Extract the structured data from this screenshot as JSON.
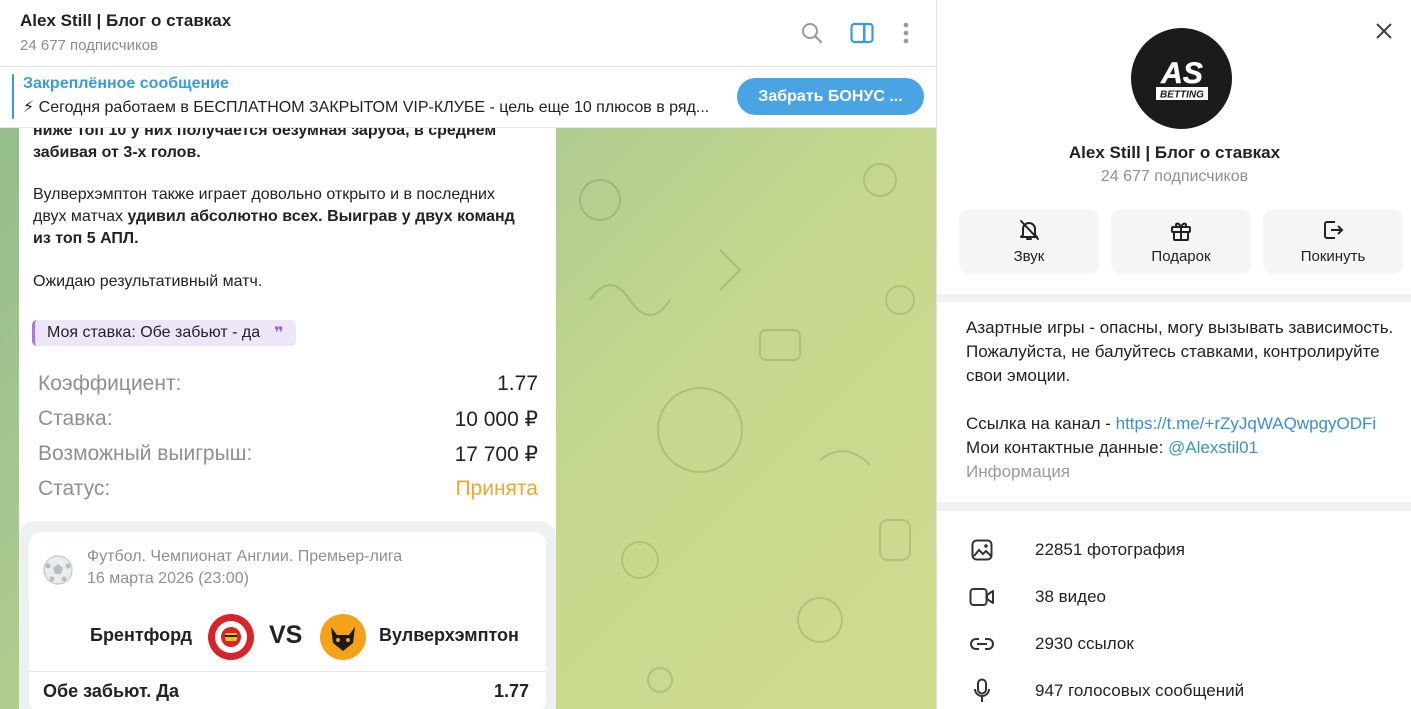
{
  "chat": {
    "title": "Alex Still | Блог о ставках",
    "subscribers": "24 677 подписчиков",
    "header_icons": [
      "search-icon",
      "sidebar-toggle-icon",
      "more-vertical-icon"
    ],
    "pinned": {
      "title": "Закреплённое сообщение",
      "text": "⚡ Сегодня работаем в БЕСПЛАТНОМ ЗАКРЫТОМ VIP-КЛУБЕ - цель еще 10 плюсов в ряд...",
      "button": "Забрать БОНУС ..."
    },
    "message": {
      "line1": "ниже топ 10 у них получается безумная заруба, в среднем",
      "line2": "забивая от 3-х голов.",
      "p2_a": "Вулверхэмптон также играет довольно открыто и в последних",
      "p2_b": "двух матчах ",
      "p2_bold": "удивил абсолютно всех. Выиграв у двух команд",
      "p2_c": "из топ 5 АПЛ.",
      "p3": "Ожидаю результативный матч.",
      "quote": "Моя ставка: Обе забьют - да",
      "quote_mark": "❞"
    },
    "bet_summary": {
      "rows": [
        {
          "label": "Коэффициент:",
          "value": "1.77"
        },
        {
          "label": "Ставка:",
          "value": "10 000 ₽"
        },
        {
          "label": "Возможный выигрыш:",
          "value": "17 700 ₽"
        },
        {
          "label": "Статус:",
          "value": "Принята"
        }
      ],
      "status_color": "#e8a933"
    },
    "match_card": {
      "league": "Футбол. Чемпионат Англии. Премьер-лига",
      "date": "16 марта 2026 (23:00)",
      "home": "Брентфорд",
      "vs": "VS",
      "away": "Вулверхэмптон",
      "bet": "Обе забьют. Да",
      "odds": "1.77"
    }
  },
  "panel": {
    "avatar_text": "AS",
    "avatar_sub": "BETTING",
    "name": "Alex Still | Блог о ставках",
    "subscribers": "24 677 подписчиков",
    "actions": [
      {
        "label": "Звук",
        "icon": "bell-off-icon"
      },
      {
        "label": "Подарок",
        "icon": "gift-icon"
      },
      {
        "label": "Покинуть",
        "icon": "logout-icon"
      }
    ],
    "info": {
      "line1": "Азартные игры - опасны, могу вызывать зависимость.",
      "line2": "Пожалуйста, не балуйтесь ставками, контролируйте",
      "line3": "свои эмоции.",
      "link_label": "Ссылка на канал - ",
      "link": "https://t.me/+rZyJqWAQwpgyODFi",
      "contact_label": "Мои контактные данные: ",
      "contact": "@Alexstil01",
      "caption": "Информация"
    },
    "media": [
      {
        "label": "22851 фотография",
        "icon": "photo-icon"
      },
      {
        "label": "38 видео",
        "icon": "video-icon"
      },
      {
        "label": "2930 ссылок",
        "icon": "link-icon"
      },
      {
        "label": "947 голосовых сообщений",
        "icon": "microphone-icon"
      }
    ],
    "accent": "#4aa4e3"
  }
}
